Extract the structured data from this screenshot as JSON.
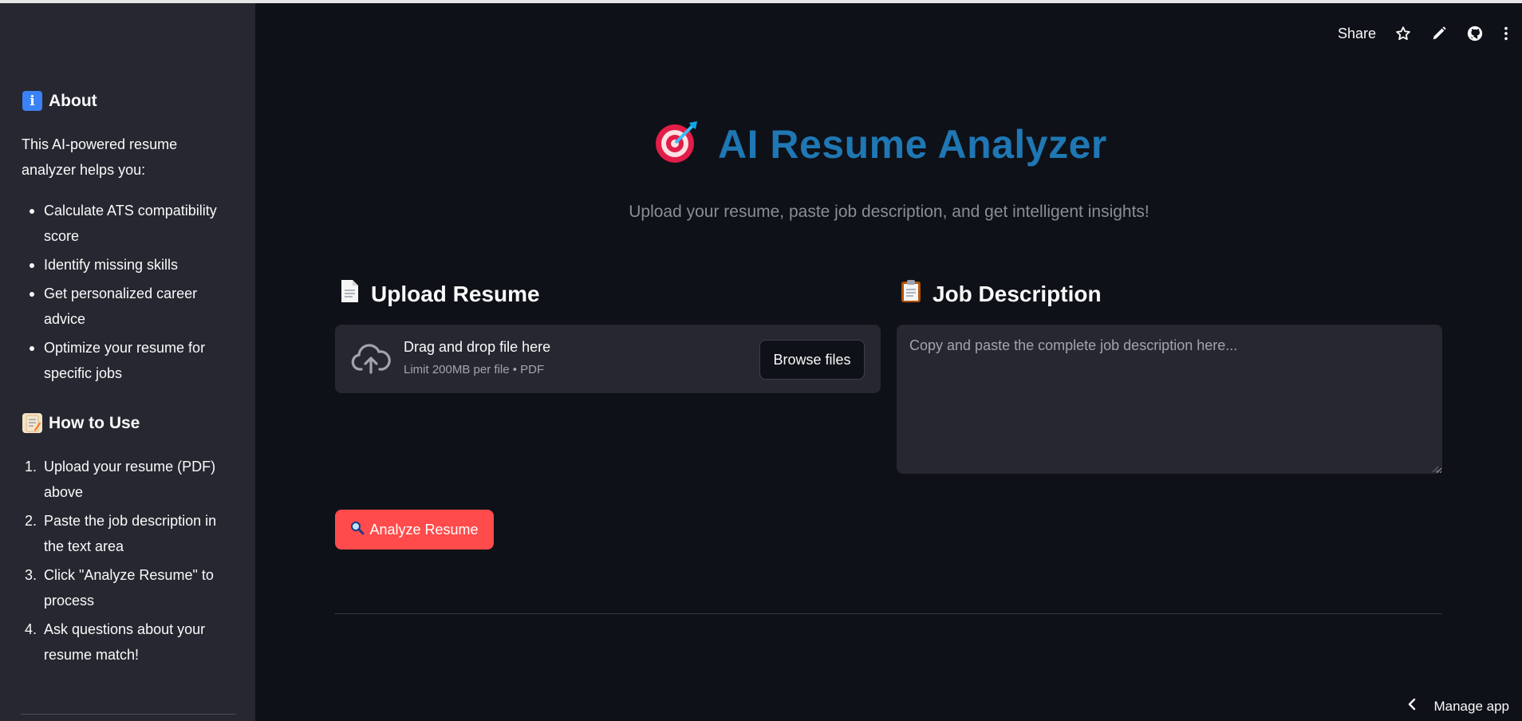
{
  "sidebar": {
    "about": {
      "icon": "info-icon",
      "icon_glyph": "i",
      "heading": "About",
      "intro": "This AI-powered resume analyzer helps you:",
      "items": [
        "Calculate ATS compatibility score",
        "Identify missing skills",
        "Get personalized career advice",
        "Optimize your resume for specific jobs"
      ]
    },
    "howto": {
      "icon": "memo-icon",
      "heading": "How to Use",
      "steps": [
        "Upload your resume (PDF) above",
        "Paste the job description in the text area",
        "Click \"Analyze Resume\" to process",
        "Ask questions about your resume match!"
      ]
    }
  },
  "toolbar": {
    "share_label": "Share",
    "icons": [
      "star-icon",
      "pencil-icon",
      "github-icon",
      "more-vertical-icon"
    ]
  },
  "main": {
    "title_icon": "target-dart-icon",
    "title": "AI Resume Analyzer",
    "subtitle": "Upload your resume, paste job description, and get intelligent insights!",
    "upload": {
      "heading": "Upload Resume",
      "heading_icon": "document-icon",
      "drag_text": "Drag and drop file here",
      "limit_text": "Limit 200MB per file • PDF",
      "browse_label": "Browse files"
    },
    "job": {
      "heading": "Job Description",
      "heading_icon": "clipboard-icon",
      "placeholder": "Copy and paste the complete job description here...",
      "value": ""
    },
    "analyze_label": "Analyze Resume",
    "analyze_icon": "magnifier-icon"
  },
  "footer": {
    "manage_label": "Manage app"
  },
  "colors": {
    "background": "#0e1117",
    "sidebar": "#262730",
    "accent": "#ff4b4b",
    "title": "#1f77b4"
  }
}
